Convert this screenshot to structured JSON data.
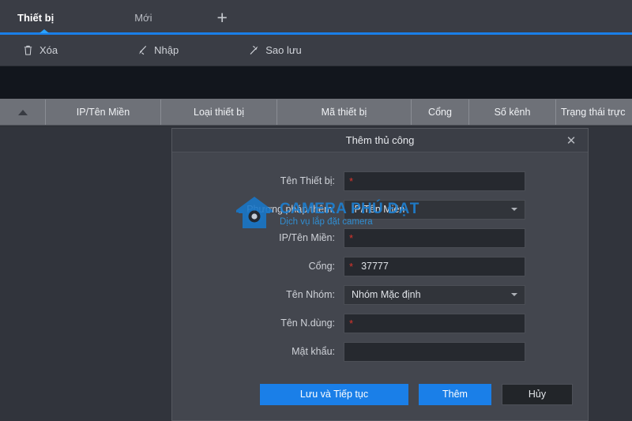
{
  "tabs": [
    {
      "label": "Thiết bị",
      "active": true
    },
    {
      "label": "Mới",
      "active": false
    },
    {
      "label": "+",
      "active": false
    }
  ],
  "toolbar": {
    "delete_label": "Xóa",
    "import_label": "Nhập",
    "backup_label": "Sao lưu"
  },
  "table": {
    "columns": [
      {
        "label": "",
        "width": 58
      },
      {
        "label": "IP/Tên Miền",
        "width": 146
      },
      {
        "label": "Loại thiết bị",
        "width": 147
      },
      {
        "label": "Mã thiết bị",
        "width": 170
      },
      {
        "label": "Cổng",
        "width": 73
      },
      {
        "label": "Số kênh",
        "width": 110
      },
      {
        "label": "Trạng thái trực",
        "width": 96
      }
    ]
  },
  "dialog": {
    "title": "Thêm thủ công",
    "close_label": "✕",
    "fields": [
      {
        "label": "Tên Thiết bị:",
        "value": "",
        "required": true,
        "type": "text"
      },
      {
        "label": "Phương pháp thêm:",
        "value": "IP/Tên Miền",
        "required": false,
        "type": "select"
      },
      {
        "label": "IP/Tên Miền:",
        "value": "",
        "required": true,
        "type": "text"
      },
      {
        "label": "Cổng:",
        "value": "37777",
        "required": true,
        "type": "text"
      },
      {
        "label": "Tên Nhóm:",
        "value": "Nhóm Mặc định",
        "required": false,
        "type": "select"
      },
      {
        "label": "Tên N.dùng:",
        "value": "",
        "required": true,
        "type": "text"
      },
      {
        "label": "Mật khẩu:",
        "value": "",
        "required": false,
        "type": "password"
      }
    ],
    "buttons": {
      "save_continue": "Lưu và Tiếp tục",
      "add": "Thêm",
      "cancel": "Hủy"
    }
  },
  "watermark": {
    "title": "CAMERA PHÚ ĐẠT",
    "subtitle": "Dịch vụ lắp đặt camera"
  },
  "colors": {
    "accent_blue": "#1a7fe8",
    "required_red": "#d9352c",
    "watermark_blue": "#1e7fd0",
    "header_gray": "#6e7178",
    "panel": "#31343c",
    "dialog": "#43464e"
  }
}
